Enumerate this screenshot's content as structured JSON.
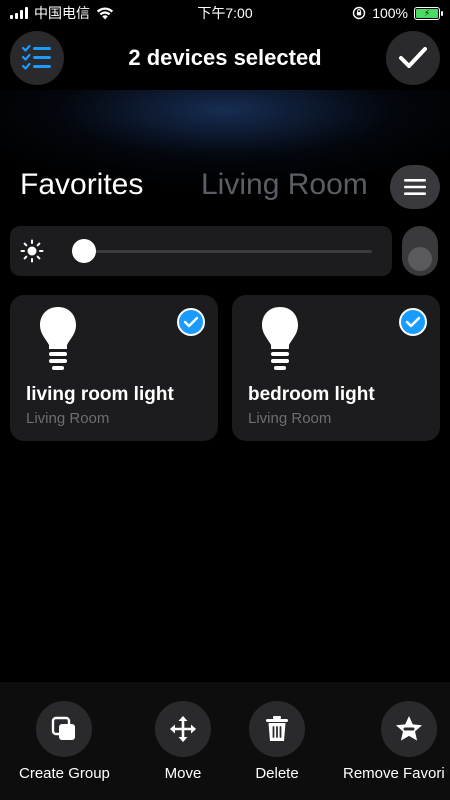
{
  "status_bar": {
    "carrier": "中国电信",
    "time": "下午7:00",
    "battery": "100%"
  },
  "header": {
    "title": "2 devices selected",
    "select_icon": "checklist-icon",
    "done_icon": "checkmark-icon"
  },
  "tabs": [
    {
      "label": "Favorites",
      "active": true
    },
    {
      "label": "Living Room",
      "active": false
    }
  ],
  "brightness": {
    "level": 0.04,
    "power_on": false
  },
  "devices": [
    {
      "name": "living room light",
      "room": "Living Room",
      "selected": true
    },
    {
      "name": "bedroom light",
      "room": "Living Room",
      "selected": true
    }
  ],
  "actions": [
    {
      "label": "Create Group",
      "icon": "copy-icon"
    },
    {
      "label": "Move",
      "icon": "move-arrows-icon"
    },
    {
      "label": "Delete",
      "icon": "trash-icon"
    },
    {
      "label": "Remove Favori",
      "icon": "star-remove-icon"
    }
  ],
  "colors": {
    "accent": "#1a9bff",
    "battery": "#4cd964",
    "card_bg": "#1c1c1e",
    "inactive_tab": "#5c5e66"
  }
}
